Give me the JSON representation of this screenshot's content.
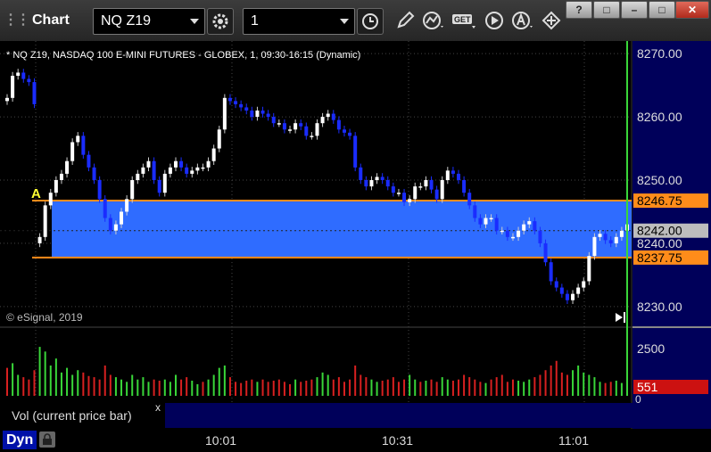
{
  "toolbar": {
    "title": "Chart",
    "symbol": "NQ Z19",
    "interval": "1",
    "icons": [
      "settings-icon",
      "clock-icon",
      "pencil-icon",
      "study-icon",
      "get-icon",
      "play-icon",
      "alert-icon",
      "move-icon"
    ],
    "window_buttons": [
      "?",
      "□",
      "–",
      "□",
      "✕"
    ]
  },
  "chart": {
    "header": "* NQ Z19, NASDAQ 100 E-MINI FUTURES - GLOBEX, 1, 09:30-16:15 (Dynamic)",
    "copyright": "© eSignal, 2019",
    "marker_label": "A",
    "price_ticks": [
      "8270.00",
      "8260.00",
      "8250.00",
      "8240.00",
      "8230.00"
    ],
    "price_tick_values": [
      8270,
      8260,
      8250,
      8240,
      8230
    ],
    "band_top_label": "8246.75",
    "band_top_value": 8246.75,
    "band_bottom_label": "8237.75",
    "band_bottom_value": 8237.75,
    "current_label": "8242.00",
    "current_value": 8242.0,
    "volume_ticks": [
      "2500"
    ],
    "volume_zero": "0",
    "volume_current": "551",
    "time_labels": [
      "10:01",
      "10:31",
      "11:01"
    ]
  },
  "legend": {
    "label": "Vol (current price bar)",
    "close": "x"
  },
  "footer": {
    "mode": "Dyn"
  },
  "colors": {
    "band": "#2f6cff",
    "band_line": "#ff8c1a",
    "up_candle": "#ffffff",
    "down_candle": "#1a2cff",
    "vol_up": "#39d639",
    "vol_down": "#d82020",
    "axis_bg": "#00005a",
    "marker": "#ffff33"
  },
  "chart_data": {
    "type": "candlestick",
    "title": "",
    "ylim": [
      8228,
      8272
    ],
    "series": [
      {
        "values": [
          8262.5,
          8263.0,
          8266.5,
          8267.0,
          8266.0,
          8265.5,
          8240.0,
          8241.0,
          8246.0,
          8248.0,
          8250.0,
          8251.0,
          8253.0,
          8256.0,
          8257.0,
          8254.0,
          8252.0,
          8250.0,
          8247.0,
          8244.0,
          8242.0,
          8243.0,
          8245.0,
          8247.0,
          8250.0,
          8251.0,
          8252.0,
          8253.0,
          8250.0,
          8248.0,
          8251.0,
          8252.0,
          8253.0,
          8252.0,
          8251.0,
          8251.5,
          8252.0,
          8252.0,
          8253.0,
          8255.0,
          8258.0,
          8263.0,
          8262.5,
          8262.0,
          8261.5,
          8261.0,
          8260.0,
          8261.0,
          8260.5,
          8260.0,
          8259.0,
          8259.0,
          8258.0,
          8258.0,
          8259.0,
          8258.5,
          8257.0,
          8257.0,
          8259.0,
          8260.0,
          8260.5,
          8259.5,
          8258.0,
          8257.5,
          8257.0,
          8252.0,
          8250.0,
          8249.0,
          8250.0,
          8250.5,
          8250.0,
          8249.0,
          8248.0,
          8248.0,
          8246.5,
          8247.0,
          8249.0,
          8249.0,
          8250.0,
          8248.5,
          8247.0,
          8250.0,
          8251.5,
          8251.0,
          8250.0,
          8248.0,
          8246.0,
          8244.0,
          8243.0,
          8244.0,
          8244.0,
          8242.0,
          8242.0,
          8241.0,
          8241.0,
          8242.0,
          8243.0,
          8243.5,
          8242.0,
          8240.0,
          8237.0,
          8234.0,
          8233.0,
          8232.0,
          8231.0,
          8232.0,
          8233.0,
          8234.0,
          8238.0,
          8241.0,
          8241.5,
          8240.5,
          8240.0,
          8241.0,
          8242.0
        ]
      },
      {
        "values": [
          8263.0,
          8266.5,
          8267.0,
          8266.0,
          8265.5,
          8262.0,
          8241.0,
          8246.0,
          8248.0,
          8250.0,
          8251.0,
          8253.0,
          8256.0,
          8257.0,
          8254.0,
          8252.0,
          8250.0,
          8247.0,
          8244.0,
          8242.0,
          8243.0,
          8245.0,
          8247.0,
          8250.0,
          8251.0,
          8252.0,
          8253.0,
          8250.0,
          8248.0,
          8251.0,
          8252.0,
          8253.0,
          8252.0,
          8251.0,
          8251.5,
          8252.0,
          8252.0,
          8253.0,
          8255.0,
          8258.0,
          8263.0,
          8262.5,
          8262.0,
          8261.5,
          8261.0,
          8260.0,
          8261.0,
          8260.5,
          8260.0,
          8259.0,
          8259.0,
          8258.0,
          8258.0,
          8259.0,
          8258.5,
          8257.0,
          8257.0,
          8259.0,
          8260.0,
          8260.5,
          8259.5,
          8258.0,
          8257.5,
          8257.0,
          8252.0,
          8250.0,
          8249.0,
          8250.0,
          8250.5,
          8250.0,
          8249.0,
          8248.0,
          8248.0,
          8246.5,
          8247.0,
          8249.0,
          8249.0,
          8250.0,
          8248.5,
          8247.0,
          8250.0,
          8251.5,
          8251.0,
          8250.0,
          8248.0,
          8246.0,
          8244.0,
          8243.0,
          8244.0,
          8244.0,
          8242.0,
          8242.0,
          8241.0,
          8241.0,
          8242.0,
          8243.0,
          8243.5,
          8242.0,
          8240.0,
          8237.0,
          8234.0,
          8233.0,
          8232.0,
          8231.0,
          8232.0,
          8233.0,
          8234.0,
          8238.0,
          8241.0,
          8241.5,
          8240.5,
          8240.0,
          8241.0,
          8242.0,
          8243.0
        ]
      },
      {
        "values": [
          1200,
          1400,
          900,
          800,
          700,
          1100,
          2100,
          1900,
          1300,
          1600,
          1000,
          1200,
          900,
          1100,
          1000,
          850,
          800,
          700,
          1300,
          900,
          800,
          700,
          600,
          900,
          700,
          800,
          600,
          700,
          650,
          700,
          600,
          900,
          700,
          800,
          650,
          500,
          600,
          700,
          900,
          1200,
          1300,
          800,
          600,
          550,
          650,
          700,
          600,
          700,
          600,
          650,
          700,
          600,
          500,
          700,
          600,
          650,
          700,
          800,
          1000,
          900,
          700,
          800,
          600,
          700,
          1300,
          900,
          800,
          700,
          600,
          650,
          700,
          800,
          600,
          700,
          900,
          700,
          600,
          650,
          700,
          600,
          800,
          700,
          650,
          700,
          900,
          800,
          700,
          600,
          550,
          700,
          800,
          900,
          600,
          700,
          650,
          600,
          700,
          800,
          900,
          1100,
          1300,
          1500,
          1000,
          900,
          1100,
          1300,
          1000,
          900,
          800,
          600,
          550,
          600,
          650,
          551
        ]
      },
      {
        "values": [
          0,
          1,
          1,
          0,
          0,
          0,
          1,
          1,
          1,
          1,
          1,
          1,
          1,
          1,
          0,
          0,
          0,
          0,
          0,
          0,
          1,
          1,
          1,
          1,
          1,
          1,
          1,
          0,
          0,
          1,
          1,
          1,
          0,
          0,
          1,
          1,
          0,
          1,
          1,
          1,
          1,
          0,
          0,
          0,
          0,
          0,
          1,
          0,
          0,
          0,
          0,
          0,
          0,
          1,
          0,
          0,
          0,
          1,
          1,
          1,
          0,
          0,
          0,
          0,
          0,
          0,
          0,
          1,
          1,
          0,
          0,
          0,
          0,
          0,
          1,
          1,
          0,
          1,
          0,
          0,
          1,
          1,
          0,
          0,
          0,
          0,
          0,
          0,
          1,
          0,
          0,
          0,
          0,
          0,
          1,
          1,
          1,
          0,
          0,
          0,
          0,
          0,
          0,
          0,
          1,
          1,
          1,
          1,
          1,
          1,
          0,
          0,
          1,
          1,
          1
        ]
      }
    ]
  }
}
